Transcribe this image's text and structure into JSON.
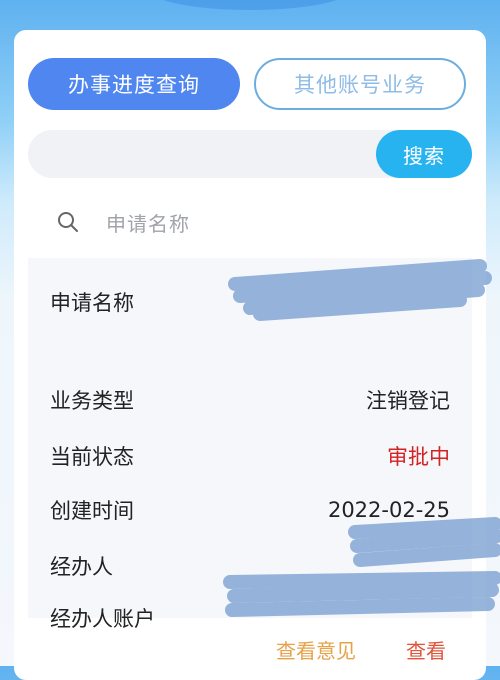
{
  "tabs": {
    "progress_label": "办事进度查询",
    "other_label": "其他账号业务"
  },
  "search": {
    "button_label": "搜索",
    "query_value": ""
  },
  "filter": {
    "placeholder": "申请名称"
  },
  "record": {
    "fields": [
      {
        "label": "申请名称",
        "value": ""
      },
      {
        "label": "业务类型",
        "value": "注销登记"
      },
      {
        "label": "当前状态",
        "value": "审批中"
      },
      {
        "label": "创建时间",
        "value": "2022-02-25"
      },
      {
        "label": "经办人",
        "value": ""
      },
      {
        "label": "经办人账户",
        "value": ""
      }
    ],
    "status_color": "#d32323"
  },
  "actions": {
    "opinion_label": "查看意见",
    "view_label": "查看"
  },
  "colors": {
    "primary": "#4f86f0",
    "search_button": "#27b3f0",
    "opinion": "#e7a24a",
    "view": "#e0553a"
  }
}
